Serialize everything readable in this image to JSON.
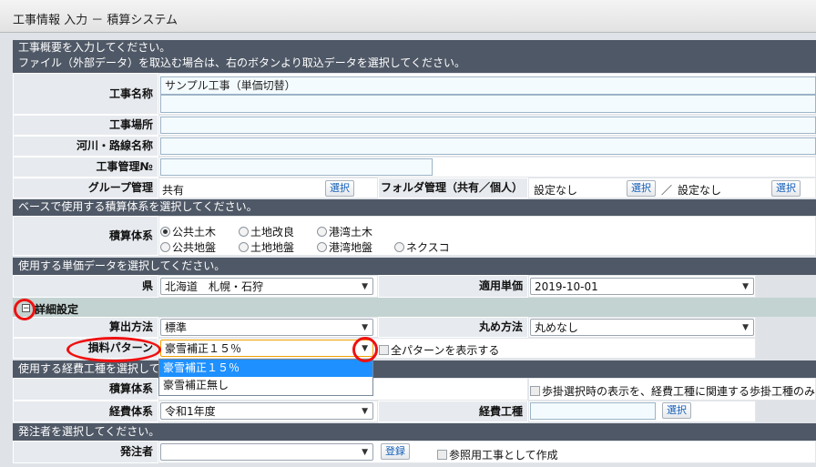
{
  "window": {
    "title": "工事情報 入力 － 積算システム"
  },
  "sections": {
    "overview_line1": "工事概要を入力してください。",
    "overview_line2": "ファイル（外部データ）を取込む場合は、右のボタンより取込データを選択してください。",
    "base": "ベースで使用する積算体系を選択してください。",
    "price": "使用する単価データを選択してください。",
    "expense": "使用する経費工種を選択してください。",
    "orderer": "発注者を選択してください。"
  },
  "fields": {
    "project_name": {
      "label": "工事名称",
      "value_line1": "サンプル工事（単価切替）",
      "value_line2": ""
    },
    "site": {
      "label": "工事場所",
      "value": ""
    },
    "river": {
      "label": "河川・路線名称",
      "value": ""
    },
    "mgmt_no": {
      "label": "工事管理№",
      "value": ""
    },
    "group": {
      "label": "グループ管理",
      "value": "共有",
      "button": "選択"
    },
    "folder": {
      "label": "フォルダ管理（共有／個人）",
      "value1": "設定なし",
      "button1": "選択",
      "sep": "／",
      "value2": "設定なし",
      "button2": "選択"
    },
    "system": {
      "label": "積算体系",
      "options": [
        "公共土木",
        "土地改良",
        "港湾土木",
        "公共地盤",
        "土地地盤",
        "港湾地盤",
        "ネクスコ"
      ],
      "selected": "公共土木"
    },
    "prefecture": {
      "label": "県",
      "value": "北海道　札幌・石狩"
    },
    "apply_price": {
      "label": "適用単価",
      "value": "2019-10-01"
    },
    "detail_toggle": "詳細設定",
    "calc_method": {
      "label": "算出方法",
      "value": "標準"
    },
    "rounding": {
      "label": "丸め方法",
      "value": "丸めなし"
    },
    "loss_pattern": {
      "label": "損料パターン",
      "value": "豪雪補正１５％",
      "show_all": "全パターンを表示する",
      "options": [
        "豪雪補正１５％",
        "豪雪補正無し"
      ],
      "highlighted": "豪雪補正１５％"
    },
    "expense_system": {
      "label": "積算体系"
    },
    "expense_note": "歩掛選択時の表示を、経費工種に関連する歩掛工種のみ",
    "expense_type": {
      "label": "経費体系",
      "value": "令和1年度"
    },
    "expense_kind": {
      "label": "経費工種",
      "value": "",
      "button": "選択"
    },
    "orderer": {
      "label": "発注者",
      "value": "",
      "button": "登録",
      "ref_checkbox": "参照用工事として作成"
    }
  },
  "colors": {
    "section_header": "#4f5866",
    "highlight": "#1e90ff",
    "annotation": "#e11111"
  }
}
